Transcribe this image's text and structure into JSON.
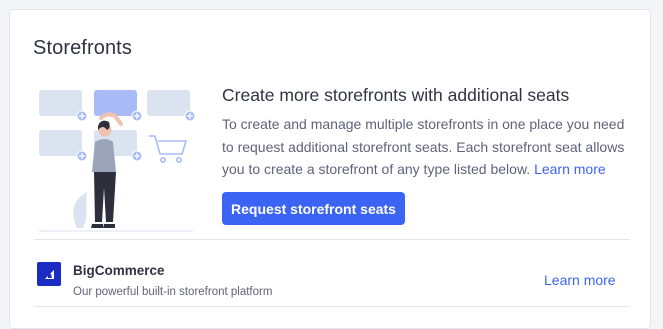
{
  "card": {
    "title": "Storefronts"
  },
  "promo": {
    "heading": "Create more storefronts with additional seats",
    "body": "To create and manage multiple storefronts in one place you need to request additional storefront seats. Each storefront seat allows you to create a storefront of any type listed below.",
    "link_label": "Learn more",
    "button_label": "Request storefront seats"
  },
  "storefronts": [
    {
      "name": "BigCommerce",
      "description": "Our powerful built-in storefront platform",
      "link_label": "Learn more",
      "logo_icon": "bigcommerce-logo-icon"
    }
  ],
  "colors": {
    "accent": "#3c64f4",
    "page_bg": "#f4f5f9",
    "heading_text": "#313440",
    "body_text": "#5e637a",
    "logo_bg": "#1b2cc4"
  }
}
